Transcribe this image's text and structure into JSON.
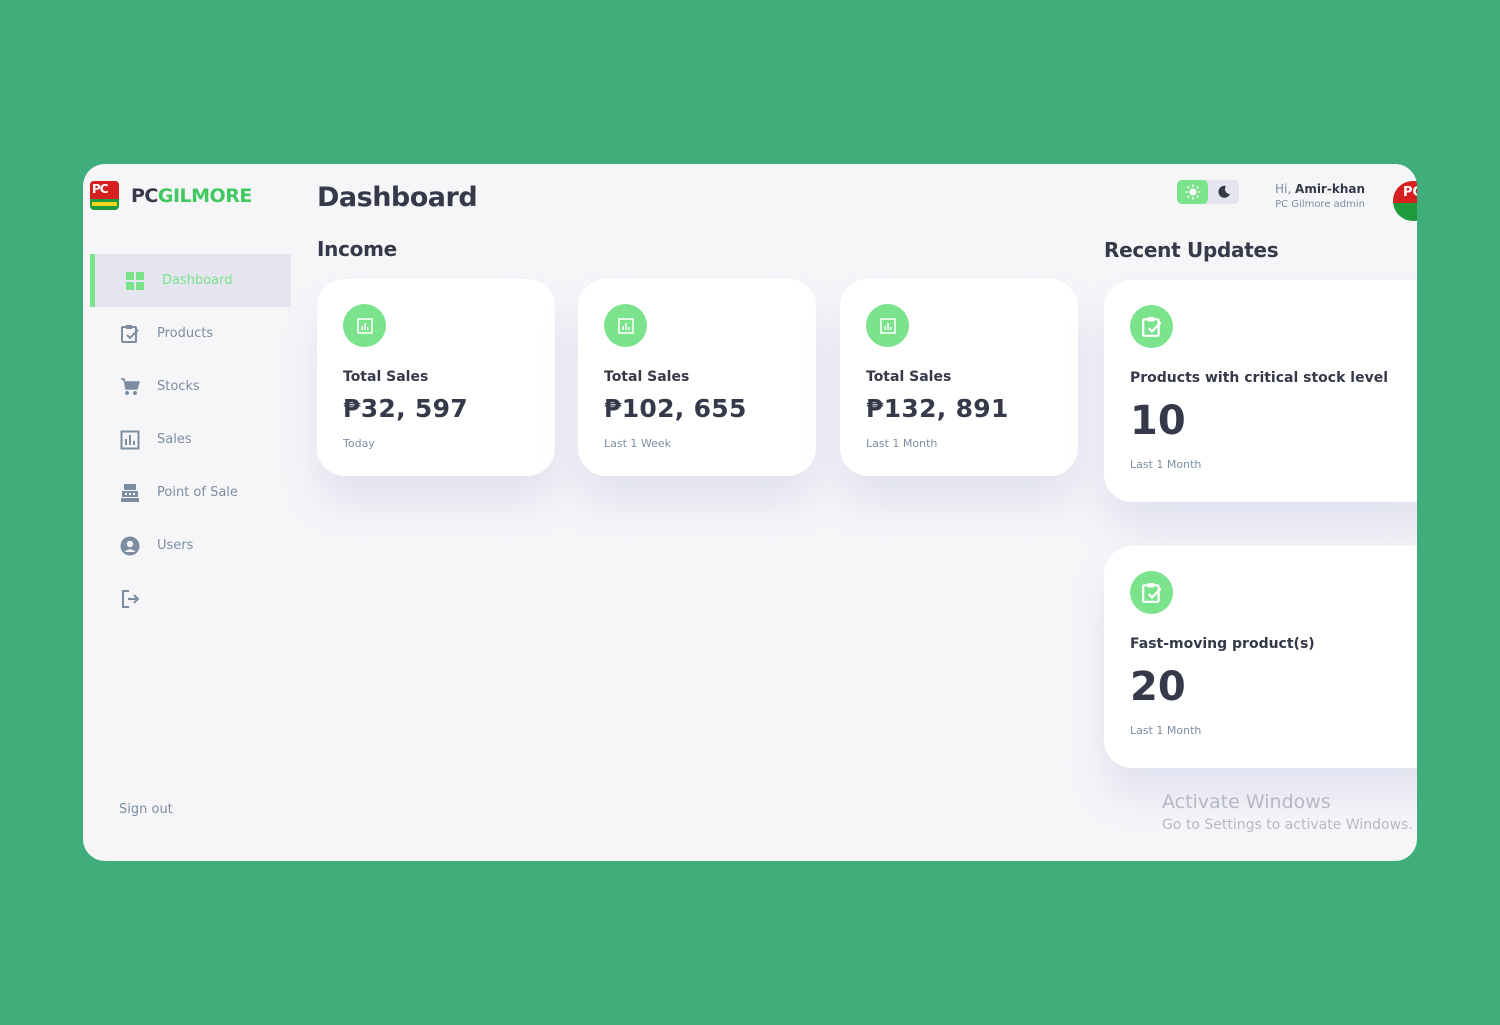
{
  "brand": {
    "part1": "PC",
    "part2": "GILMORE",
    "badge_text": "PC"
  },
  "sidebar": {
    "items": [
      {
        "label": "Dashboard",
        "icon": "grid-icon"
      },
      {
        "label": "Products",
        "icon": "clipboard-check-icon"
      },
      {
        "label": "Stocks",
        "icon": "cart-icon"
      },
      {
        "label": "Sales",
        "icon": "bar-chart-icon"
      },
      {
        "label": "Point of Sale",
        "icon": "cash-register-icon"
      },
      {
        "label": "Users",
        "icon": "user-circle-icon"
      },
      {
        "label": "",
        "icon": "logout-icon"
      }
    ],
    "signout": "Sign out"
  },
  "header": {
    "title": "Dashboard",
    "greeting": "Hi,",
    "username": "Amir-khan",
    "role": "PC Gilmore admin"
  },
  "income": {
    "title": "Income",
    "cards": [
      {
        "label": "Total Sales",
        "value": "₱32, 597",
        "period": "Today"
      },
      {
        "label": "Total Sales",
        "value": "₱102, 655",
        "period": "Last 1 Week"
      },
      {
        "label": "Total Sales",
        "value": "₱132, 891",
        "period": "Last 1 Month"
      }
    ]
  },
  "updates": {
    "title": "Recent Updates",
    "cards": [
      {
        "label": "Products with critical stock level",
        "value": "10",
        "period": "Last 1 Month"
      },
      {
        "label": "Fast-moving product(s)",
        "value": "20",
        "period": "Last 1 Month"
      }
    ]
  },
  "watermark": {
    "line1": "Activate Windows",
    "line2": "Go to Settings to activate Windows."
  },
  "colors": {
    "accent": "#7ce38d",
    "dark": "#363949",
    "muted": "#7d8da1",
    "background": "#3fae7a"
  }
}
